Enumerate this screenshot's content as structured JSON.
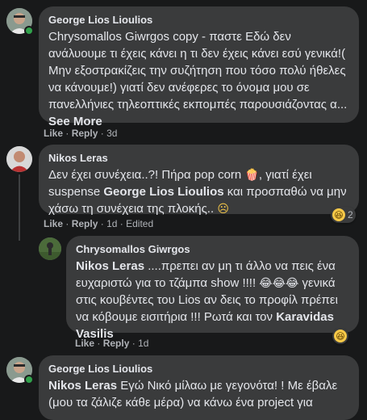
{
  "comments": [
    {
      "author": "George Lios Lioulios",
      "text": "Chrysomallos Giwrgos copy - παστε Εδώ δεν ανάλυουμε τι έχεις κάνει η τι δεν έχεις κάνει εσύ γενικά!( Μην εξοστρακίζεις την συζήτηση που τόσο πολύ ήθελες να κάνουμε!) γιατί δεν ανέφερες το όνομα μου σε πανελλήνιες τηλεοπτικές εκπομπές παρουσιάζοντας α...",
      "see_more": "See More",
      "like": "Like",
      "reply": "Reply",
      "time": "3d"
    },
    {
      "author": "Nikos Leras",
      "text_a": "Δεν έχει συνέχεια..?! Πήρα pop corn",
      "emoji_popcorn": "🍿",
      "text_b": ", γιατί έχει suspense",
      "mention": "George Lios Lioulios",
      "text_c": "και προσπαθώ να μην χάσω τη συνέχεια της πλοκής..",
      "emoji_sad": "☹",
      "like": "Like",
      "reply": "Reply",
      "time": "1d",
      "edited": "Edited",
      "reaction_count": "2",
      "reaction_icon": "😆"
    },
    {
      "author": "Chrysomallos Giwrgos",
      "mention_a": "Nikos Leras",
      "text_a": "....πρεπει αν μη τι άλλο να πεις ένα ευχαριστώ για το τζάμπα show !!!!",
      "emojis": "😂😂😂",
      "text_b": "γενικά στις κουβέντες του Lios αν δεις το προφίλ πρέπει να κόβουμε εισιτήρια !!! Ρωτά και τον",
      "mention_b": "Karavidas Vasilis",
      "like": "Like",
      "reply": "Reply",
      "time": "1d",
      "reaction_icon": "😆"
    },
    {
      "author": "George Lios Lioulios",
      "mention": "Nikos Leras",
      "text": "Εγώ Νικό μίλαω με γεγονότα! ! Με έβαλε (μου τα ζάλιζε κάθε μέρα) να κάνω ένα project για"
    }
  ],
  "separator": "·",
  "colors": {
    "background": "#18191a",
    "bubble": "#3a3b3c",
    "text": "#e4e6eb",
    "secondary": "#b0b3b8",
    "online": "#31a24c"
  }
}
